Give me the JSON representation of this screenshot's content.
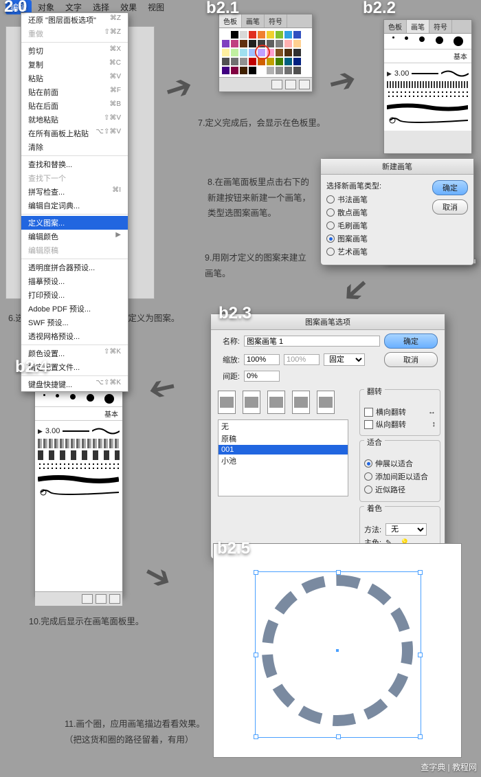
{
  "labels": {
    "b20": "2.0",
    "b21": "b2.1",
    "b22": "b2.2",
    "b23": "b2.3",
    "b24": "b2.4",
    "b25": "b2.5"
  },
  "menubar": {
    "items": [
      "编辑",
      "对象",
      "文字",
      "选择",
      "效果",
      "视图"
    ],
    "active": 0
  },
  "menu": {
    "groups": [
      [
        {
          "label": "还原 \"图层面板选项\"",
          "sc": "⌘Z"
        },
        {
          "label": "重做",
          "sc": "⇧⌘Z",
          "disabled": true
        }
      ],
      [
        {
          "label": "剪切",
          "sc": "⌘X"
        },
        {
          "label": "复制",
          "sc": "⌘C"
        },
        {
          "label": "粘贴",
          "sc": "⌘V"
        },
        {
          "label": "贴在前面",
          "sc": "⌘F"
        },
        {
          "label": "贴在后面",
          "sc": "⌘B"
        },
        {
          "label": "就地粘贴",
          "sc": "⇧⌘V"
        },
        {
          "label": "在所有画板上粘贴",
          "sc": "⌥⇧⌘V"
        },
        {
          "label": "清除",
          "sc": ""
        }
      ],
      [
        {
          "label": "查找和替换...",
          "sc": ""
        },
        {
          "label": "查找下一个",
          "sc": "",
          "disabled": true
        },
        {
          "label": "拼写检查...",
          "sc": "⌘I"
        },
        {
          "label": "编辑自定词典...",
          "sc": ""
        }
      ],
      [
        {
          "label": "定义图案...",
          "sc": "",
          "highlight": true
        },
        {
          "label": "编辑颜色",
          "sc": "▶"
        },
        {
          "label": "编辑原稿",
          "sc": "",
          "disabled": true
        }
      ],
      [
        {
          "label": "透明度拼合器预设...",
          "sc": ""
        },
        {
          "label": "描摹预设...",
          "sc": ""
        },
        {
          "label": "打印预设...",
          "sc": ""
        },
        {
          "label": "Adobe PDF 预设...",
          "sc": ""
        },
        {
          "label": "SWF 预设...",
          "sc": ""
        },
        {
          "label": "透视网格预设...",
          "sc": ""
        }
      ],
      [
        {
          "label": "颜色设置...",
          "sc": "⇧⌘K"
        },
        {
          "label": "指定配置文件...",
          "sc": ""
        }
      ],
      [
        {
          "label": "键盘快捷键...",
          "sc": "⌥⇧⌘K"
        }
      ]
    ]
  },
  "captions": {
    "c6": "6.选中（b1）得到的图形，将其定义为图案。",
    "c7": "7.定义完成后，会显示在色板里。",
    "c8a": "8.在画笔面板里点击右下的",
    "c8b": "新建按钮来新建一个画笔，",
    "c8c": "类型选图案画笔。",
    "c9a": "9.用刚才定义的图案来建立",
    "c9b": "画笔。",
    "c10": "10.完成后显示在画笔面板里。",
    "c11a": "11.画个圈，应用画笔描边看看效果。",
    "c11b": "（把这货和圈的路径留着，有用）"
  },
  "tabs": {
    "swatches": [
      "色板",
      "画笔",
      "符号"
    ],
    "brushes": [
      "色板",
      "画笔",
      "符号"
    ]
  },
  "swatch_colors": [
    "#fff",
    "#000",
    "#d8d8d8",
    "#e03020",
    "#f08030",
    "#f0d030",
    "#80c030",
    "#30a0e0",
    "#3050c0",
    "#8040c0",
    "#c04080",
    "#603010",
    "#202020",
    "#404040",
    "#606060",
    "#808080",
    "#ffb0b0",
    "#ffd090",
    "#fff0a0",
    "#c0f0a0",
    "#a0e0f0",
    "#a0c0ff",
    "#c0a0ff",
    "#ffa0d0",
    "#805020",
    "#503010",
    "#303030",
    "#505050",
    "#707070",
    "#909090",
    "#c00000",
    "#d06000",
    "#c0a000",
    "#408000",
    "#006080",
    "#002080",
    "#400080",
    "#800040",
    "#402000",
    "#000",
    "#fff",
    "#b0b0b0",
    "#909090",
    "#707070",
    "#505050"
  ],
  "newbrush": {
    "title": "新建画笔",
    "prompt": "选择新画笔类型:",
    "options": [
      "书法画笔",
      "散点画笔",
      "毛刷画笔",
      "图案画笔",
      "艺术画笔"
    ],
    "checked": 3,
    "ok": "确定",
    "cancel": "取消"
  },
  "pboptions": {
    "title": "图案画笔选项",
    "name_lbl": "名称:",
    "name": "图案画笔 1",
    "scale_lbl": "缩放:",
    "scale": "100%",
    "scale2": "100%",
    "scale_mode": "固定",
    "gap_lbl": "间距:",
    "gap": "0%",
    "list": [
      "无",
      "原稿",
      "001",
      "小池"
    ],
    "list_sel": 2,
    "flip_title": "翻转",
    "flip_h": "横向翻转",
    "flip_v": "纵向翻转",
    "fit_title": "适合",
    "fit_opts": [
      "伸展以适合",
      "添加间距以适合",
      "近似路径"
    ],
    "fit_sel": 0,
    "color_title": "着色",
    "method_lbl": "方法:",
    "method": "无",
    "keycolor_lbl": "主色:",
    "ok": "确定",
    "cancel": "取消"
  },
  "brush_info": {
    "size": "3.00",
    "basic": "基本"
  },
  "watermark": "查字典 | 教程网"
}
